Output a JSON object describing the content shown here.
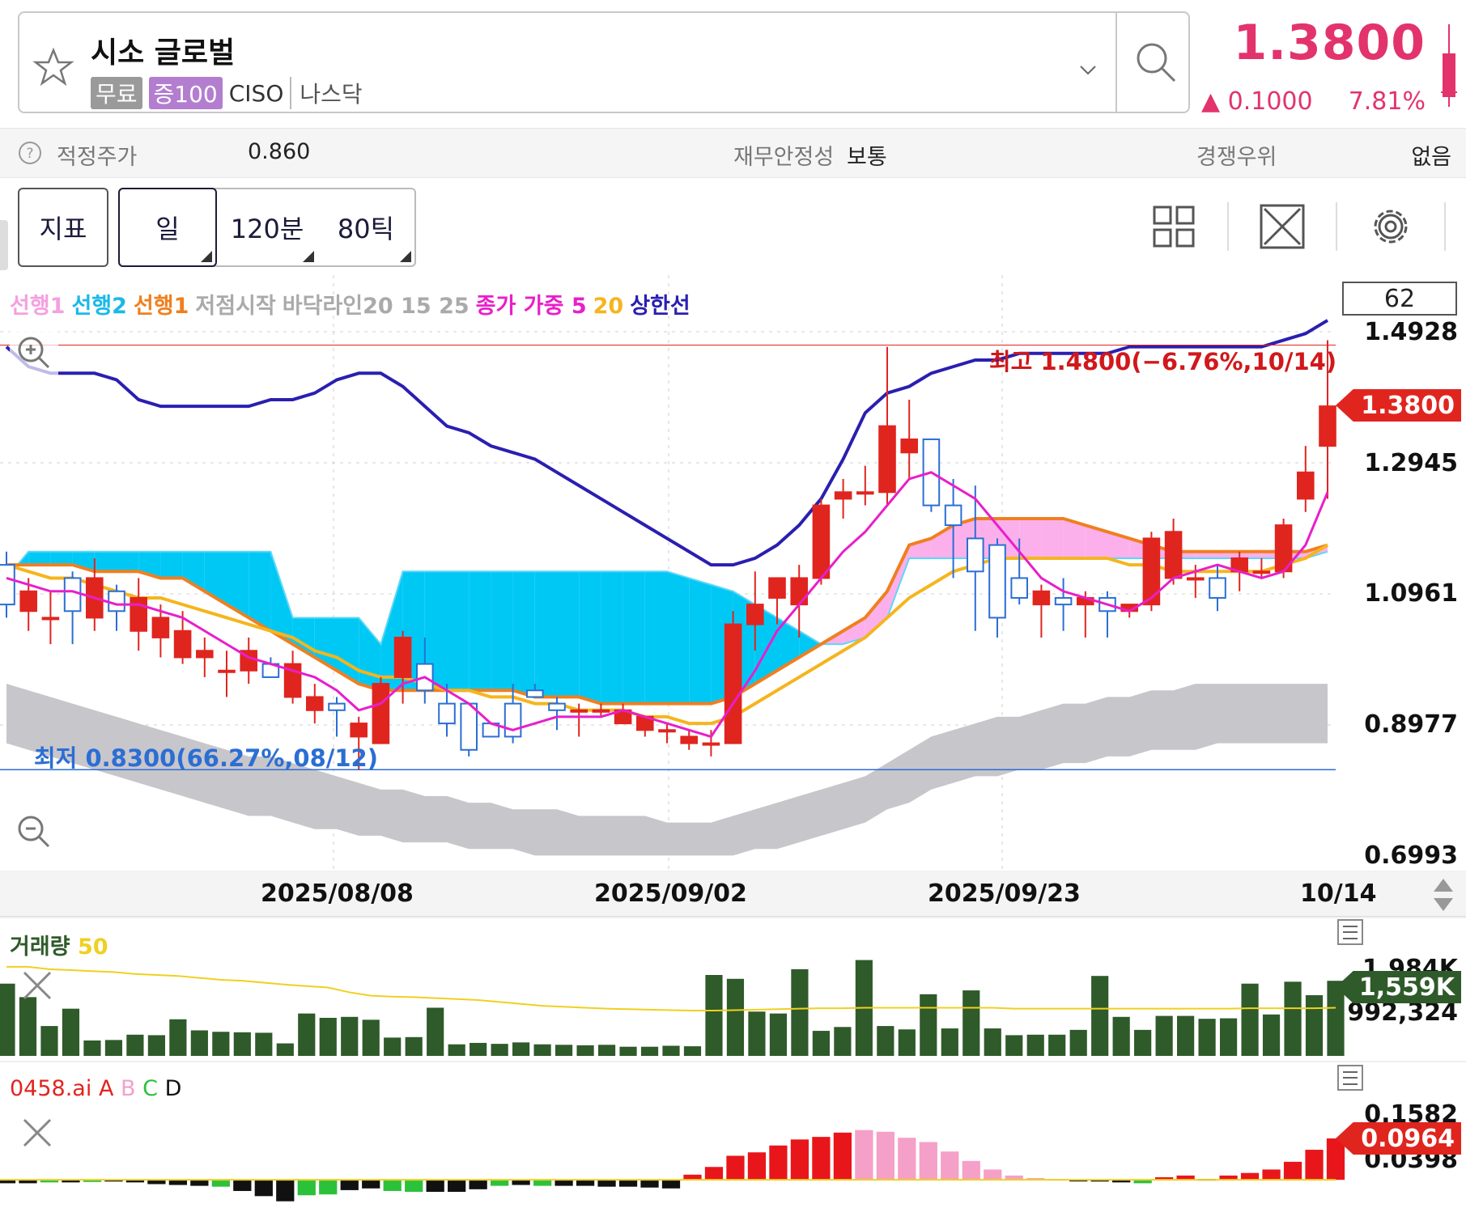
{
  "header": {
    "stock_name": "시소 글로벌",
    "tag_free": "무료",
    "tag_margin": "증100",
    "ticker": "CISO",
    "exchange": "나스닥",
    "price": "1.3800",
    "change": "▲ 0.1000",
    "change_pct": "7.81%",
    "accent_color": "#e2336d"
  },
  "info_row": {
    "fair_price_label": "적정주가",
    "fair_price_value": "0.860",
    "stability_label": "재무안정성",
    "stability_value": "보통",
    "competitive_label": "경쟁우위",
    "competitive_value": "없음"
  },
  "toolbar": {
    "indicator_btn": "지표",
    "period_day": "일",
    "period_120min": "120분",
    "period_80tick": "80틱",
    "icons": [
      "grid-layout-icon",
      "expand-icon",
      "gear-icon",
      "tools-icon"
    ]
  },
  "legend": {
    "lead1_pink": "선행1",
    "lead2": "선행2",
    "lead1_orange": "선행1",
    "low_start": "저점시작",
    "bottom_line": "바닥라인20 15 25",
    "close_weighted": "종가 가중 5",
    "ma20": "20",
    "upper": "상한선",
    "y_box": "62"
  },
  "price_chart": {
    "y_labels": [
      "1.4928",
      "1.2945",
      "1.0961",
      "0.8977",
      "0.6993"
    ],
    "x_labels": [
      "2025/08/08",
      "2025/09/02",
      "2025/09/23",
      "10/14"
    ],
    "high_annotation": "최고 1.4800(−6.76%,10/14)",
    "low_annotation": "최저 0.8300(66.27%,08/12)",
    "current_tag": "1.3800"
  },
  "volume_panel": {
    "title": "거래량",
    "ma_label": "50",
    "labels": [
      "1,984K",
      "992,324"
    ],
    "current_tag": "1,559K"
  },
  "ai_panel": {
    "title": "0458.ai",
    "a": "A",
    "b": "B",
    "c": "C",
    "d": "D",
    "labels": [
      "0.1582",
      "0.0398"
    ],
    "current_tag": "0.0964"
  },
  "chart_data": {
    "type": "candlestick",
    "ylim": [
      0.6993,
      1.4928
    ],
    "candles": [
      {
        "o": 1.14,
        "h": 1.16,
        "l": 1.06,
        "c": 1.08
      },
      {
        "o": 1.07,
        "h": 1.12,
        "l": 1.04,
        "c": 1.1
      },
      {
        "o": 1.06,
        "h": 1.1,
        "l": 1.02,
        "c": 1.06
      },
      {
        "o": 1.12,
        "h": 1.13,
        "l": 1.02,
        "c": 1.07
      },
      {
        "o": 1.06,
        "h": 1.15,
        "l": 1.04,
        "c": 1.12
      },
      {
        "o": 1.1,
        "h": 1.11,
        "l": 1.04,
        "c": 1.07
      },
      {
        "o": 1.04,
        "h": 1.12,
        "l": 1.01,
        "c": 1.09
      },
      {
        "o": 1.03,
        "h": 1.08,
        "l": 1.0,
        "c": 1.06
      },
      {
        "o": 1.0,
        "h": 1.07,
        "l": 0.99,
        "c": 1.04
      },
      {
        "o": 1.0,
        "h": 1.03,
        "l": 0.97,
        "c": 1.01
      },
      {
        "o": 0.98,
        "h": 1.01,
        "l": 0.94,
        "c": 0.98
      },
      {
        "o": 0.98,
        "h": 1.03,
        "l": 0.96,
        "c": 1.01
      },
      {
        "o": 0.99,
        "h": 1.0,
        "l": 0.97,
        "c": 0.97
      },
      {
        "o": 0.94,
        "h": 1.01,
        "l": 0.93,
        "c": 0.99
      },
      {
        "o": 0.92,
        "h": 0.96,
        "l": 0.9,
        "c": 0.94
      },
      {
        "o": 0.93,
        "h": 0.94,
        "l": 0.88,
        "c": 0.92
      },
      {
        "o": 0.88,
        "h": 0.91,
        "l": 0.83,
        "c": 0.9
      },
      {
        "o": 0.87,
        "h": 0.97,
        "l": 0.87,
        "c": 0.96
      },
      {
        "o": 0.97,
        "h": 1.04,
        "l": 0.93,
        "c": 1.03
      },
      {
        "o": 0.99,
        "h": 1.03,
        "l": 0.93,
        "c": 0.95
      },
      {
        "o": 0.93,
        "h": 0.96,
        "l": 0.88,
        "c": 0.9
      },
      {
        "o": 0.93,
        "h": 0.93,
        "l": 0.85,
        "c": 0.86
      },
      {
        "o": 0.9,
        "h": 0.9,
        "l": 0.88,
        "c": 0.88
      },
      {
        "o": 0.93,
        "h": 0.96,
        "l": 0.87,
        "c": 0.88
      },
      {
        "o": 0.95,
        "h": 0.96,
        "l": 0.94,
        "c": 0.94
      },
      {
        "o": 0.93,
        "h": 0.94,
        "l": 0.89,
        "c": 0.92
      },
      {
        "o": 0.92,
        "h": 0.93,
        "l": 0.88,
        "c": 0.92
      },
      {
        "o": 0.92,
        "h": 0.93,
        "l": 0.91,
        "c": 0.92
      },
      {
        "o": 0.9,
        "h": 0.93,
        "l": 0.9,
        "c": 0.92
      },
      {
        "o": 0.89,
        "h": 0.91,
        "l": 0.88,
        "c": 0.91
      },
      {
        "o": 0.89,
        "h": 0.9,
        "l": 0.87,
        "c": 0.89
      },
      {
        "o": 0.87,
        "h": 0.89,
        "l": 0.86,
        "c": 0.88
      },
      {
        "o": 0.87,
        "h": 0.89,
        "l": 0.85,
        "c": 0.87
      },
      {
        "o": 0.87,
        "h": 1.07,
        "l": 0.87,
        "c": 1.05
      },
      {
        "o": 1.05,
        "h": 1.13,
        "l": 1.01,
        "c": 1.08
      },
      {
        "o": 1.09,
        "h": 1.12,
        "l": 1.05,
        "c": 1.12
      },
      {
        "o": 1.08,
        "h": 1.14,
        "l": 1.03,
        "c": 1.12
      },
      {
        "o": 1.12,
        "h": 1.24,
        "l": 1.11,
        "c": 1.23
      },
      {
        "o": 1.24,
        "h": 1.27,
        "l": 1.21,
        "c": 1.25
      },
      {
        "o": 1.25,
        "h": 1.29,
        "l": 1.23,
        "c": 1.25
      },
      {
        "o": 1.25,
        "h": 1.47,
        "l": 1.23,
        "c": 1.35
      },
      {
        "o": 1.31,
        "h": 1.39,
        "l": 1.27,
        "c": 1.33
      },
      {
        "o": 1.33,
        "h": 1.33,
        "l": 1.22,
        "c": 1.23
      },
      {
        "o": 1.23,
        "h": 1.27,
        "l": 1.12,
        "c": 1.2
      },
      {
        "o": 1.18,
        "h": 1.26,
        "l": 1.04,
        "c": 1.13
      },
      {
        "o": 1.17,
        "h": 1.18,
        "l": 1.03,
        "c": 1.06
      },
      {
        "o": 1.12,
        "h": 1.18,
        "l": 1.08,
        "c": 1.09
      },
      {
        "o": 1.08,
        "h": 1.11,
        "l": 1.03,
        "c": 1.1
      },
      {
        "o": 1.09,
        "h": 1.12,
        "l": 1.04,
        "c": 1.08
      },
      {
        "o": 1.08,
        "h": 1.1,
        "l": 1.03,
        "c": 1.09
      },
      {
        "o": 1.09,
        "h": 1.1,
        "l": 1.03,
        "c": 1.07
      },
      {
        "o": 1.07,
        "h": 1.08,
        "l": 1.06,
        "c": 1.08
      },
      {
        "o": 1.08,
        "h": 1.19,
        "l": 1.07,
        "c": 1.18
      },
      {
        "o": 1.12,
        "h": 1.21,
        "l": 1.11,
        "c": 1.19
      },
      {
        "o": 1.12,
        "h": 1.14,
        "l": 1.09,
        "c": 1.12
      },
      {
        "o": 1.12,
        "h": 1.14,
        "l": 1.07,
        "c": 1.09
      },
      {
        "o": 1.13,
        "h": 1.16,
        "l": 1.1,
        "c": 1.15
      },
      {
        "o": 1.13,
        "h": 1.15,
        "l": 1.12,
        "c": 1.13
      },
      {
        "o": 1.13,
        "h": 1.21,
        "l": 1.12,
        "c": 1.2
      },
      {
        "o": 1.24,
        "h": 1.32,
        "l": 1.22,
        "c": 1.28
      },
      {
        "o": 1.32,
        "h": 1.48,
        "l": 1.24,
        "c": 1.38
      }
    ],
    "ma5": [
      1.12,
      1.11,
      1.1,
      1.1,
      1.09,
      1.08,
      1.08,
      1.07,
      1.06,
      1.04,
      1.02,
      1.0,
      0.99,
      0.98,
      0.97,
      0.95,
      0.92,
      0.93,
      0.96,
      0.97,
      0.95,
      0.93,
      0.9,
      0.89,
      0.9,
      0.91,
      0.91,
      0.91,
      0.92,
      0.91,
      0.9,
      0.89,
      0.88,
      0.93,
      0.98,
      1.04,
      1.08,
      1.12,
      1.16,
      1.19,
      1.23,
      1.27,
      1.28,
      1.26,
      1.24,
      1.2,
      1.16,
      1.12,
      1.1,
      1.09,
      1.08,
      1.07,
      1.09,
      1.12,
      1.13,
      1.14,
      1.13,
      1.12,
      1.13,
      1.17,
      1.25
    ],
    "ma20": [
      1.14,
      1.13,
      1.12,
      1.12,
      1.11,
      1.1,
      1.09,
      1.09,
      1.08,
      1.07,
      1.06,
      1.05,
      1.04,
      1.03,
      1.01,
      1.0,
      0.98,
      0.97,
      0.97,
      0.96,
      0.95,
      0.95,
      0.94,
      0.94,
      0.93,
      0.93,
      0.92,
      0.92,
      0.92,
      0.91,
      0.91,
      0.9,
      0.9,
      0.91,
      0.93,
      0.95,
      0.97,
      0.99,
      1.01,
      1.03,
      1.06,
      1.09,
      1.11,
      1.13,
      1.14,
      1.15,
      1.15,
      1.15,
      1.15,
      1.15,
      1.15,
      1.14,
      1.14,
      1.13,
      1.13,
      1.13,
      1.13,
      1.13,
      1.14,
      1.15,
      1.17
    ],
    "upper": [
      1.47,
      1.44,
      1.43,
      1.43,
      1.43,
      1.42,
      1.39,
      1.38,
      1.38,
      1.38,
      1.38,
      1.38,
      1.39,
      1.39,
      1.4,
      1.42,
      1.43,
      1.43,
      1.41,
      1.38,
      1.35,
      1.34,
      1.32,
      1.31,
      1.3,
      1.28,
      1.26,
      1.24,
      1.22,
      1.2,
      1.18,
      1.16,
      1.14,
      1.14,
      1.15,
      1.17,
      1.2,
      1.24,
      1.3,
      1.37,
      1.4,
      1.41,
      1.43,
      1.44,
      1.45,
      1.45,
      1.46,
      1.46,
      1.46,
      1.46,
      1.46,
      1.47,
      1.47,
      1.47,
      1.47,
      1.47,
      1.47,
      1.47,
      1.48,
      1.49,
      1.51
    ],
    "lead1": [
      1.14,
      1.14,
      1.14,
      1.14,
      1.13,
      1.13,
      1.13,
      1.12,
      1.12,
      1.1,
      1.08,
      1.06,
      1.04,
      1.02,
      1.0,
      0.98,
      0.96,
      0.95,
      0.95,
      0.95,
      0.95,
      0.95,
      0.95,
      0.95,
      0.94,
      0.94,
      0.94,
      0.93,
      0.93,
      0.93,
      0.93,
      0.93,
      0.93,
      0.94,
      0.96,
      0.98,
      1.0,
      1.02,
      1.04,
      1.06,
      1.1,
      1.17,
      1.18,
      1.2,
      1.21,
      1.21,
      1.21,
      1.21,
      1.21,
      1.2,
      1.19,
      1.18,
      1.17,
      1.16,
      1.16,
      1.16,
      1.16,
      1.16,
      1.16,
      1.16,
      1.17
    ],
    "lead2": [
      1.12,
      1.16,
      1.16,
      1.16,
      1.16,
      1.16,
      1.16,
      1.16,
      1.16,
      1.16,
      1.16,
      1.16,
      1.16,
      1.06,
      1.06,
      1.06,
      1.06,
      1.02,
      1.13,
      1.13,
      1.13,
      1.13,
      1.13,
      1.13,
      1.13,
      1.13,
      1.13,
      1.13,
      1.13,
      1.13,
      1.13,
      1.12,
      1.11,
      1.1,
      1.08,
      1.06,
      1.04,
      1.02,
      1.02,
      1.03,
      1.06,
      1.15,
      1.15,
      1.15,
      1.15,
      1.15,
      1.15,
      1.15,
      1.15,
      1.15,
      1.15,
      1.15,
      1.15,
      1.15,
      1.15,
      1.15,
      1.15,
      1.15,
      1.15,
      1.15,
      1.16
    ],
    "band_top": [
      0.96,
      0.95,
      0.94,
      0.93,
      0.92,
      0.91,
      0.9,
      0.89,
      0.88,
      0.87,
      0.86,
      0.85,
      0.85,
      0.84,
      0.83,
      0.82,
      0.81,
      0.8,
      0.8,
      0.79,
      0.79,
      0.78,
      0.78,
      0.77,
      0.77,
      0.77,
      0.76,
      0.76,
      0.76,
      0.76,
      0.75,
      0.75,
      0.75,
      0.76,
      0.77,
      0.78,
      0.79,
      0.8,
      0.81,
      0.82,
      0.84,
      0.86,
      0.88,
      0.89,
      0.9,
      0.91,
      0.91,
      0.92,
      0.93,
      0.93,
      0.94,
      0.94,
      0.95,
      0.95,
      0.96,
      0.96,
      0.96,
      0.96,
      0.96,
      0.96,
      0.96
    ],
    "band_bottom": [
      0.87,
      0.86,
      0.85,
      0.84,
      0.83,
      0.82,
      0.81,
      0.8,
      0.79,
      0.78,
      0.77,
      0.76,
      0.76,
      0.75,
      0.74,
      0.74,
      0.73,
      0.73,
      0.72,
      0.72,
      0.72,
      0.71,
      0.71,
      0.71,
      0.7,
      0.7,
      0.7,
      0.7,
      0.7,
      0.7,
      0.7,
      0.7,
      0.7,
      0.7,
      0.71,
      0.71,
      0.72,
      0.73,
      0.74,
      0.75,
      0.77,
      0.78,
      0.8,
      0.81,
      0.82,
      0.82,
      0.83,
      0.83,
      0.84,
      0.84,
      0.85,
      0.85,
      0.86,
      0.86,
      0.86,
      0.87,
      0.87,
      0.87,
      0.87,
      0.87,
      0.87
    ],
    "volume_ylim": [
      0,
      2100
    ],
    "volume": [
      1500,
      1220,
      620,
      980,
      320,
      330,
      440,
      430,
      760,
      530,
      500,
      490,
      480,
      260,
      880,
      790,
      810,
      750,
      380,
      390,
      1000,
      240,
      270,
      250,
      280,
      240,
      230,
      220,
      230,
      190,
      190,
      210,
      200,
      1680,
      1600,
      920,
      880,
      1800,
      520,
      600,
      1990,
      620,
      550,
      1280,
      570,
      1360,
      570,
      430,
      440,
      440,
      540,
      1660,
      810,
      540,
      830,
      830,
      770,
      780,
      1500,
      860,
      1540,
      1260,
      1559
    ],
    "volume_ma50": [
      1850,
      1850,
      1800,
      1780,
      1760,
      1740,
      1700,
      1680,
      1660,
      1620,
      1580,
      1560,
      1520,
      1480,
      1450,
      1420,
      1320,
      1250,
      1230,
      1220,
      1200,
      1180,
      1160,
      1120,
      1080,
      1040,
      1020,
      1000,
      980,
      970,
      960,
      950,
      940,
      940,
      950,
      960,
      970,
      980,
      990,
      990,
      1000,
      1000,
      1000,
      1000,
      1000,
      1000,
      1000,
      980,
      980,
      980,
      980,
      980,
      980,
      980,
      980,
      980,
      980,
      980,
      990,
      990,
      990,
      990,
      1000
    ],
    "ai_ylim": [
      -0.06,
      0.17
    ],
    "ai_values": [
      -0.008,
      -0.008,
      -0.006,
      -0.006,
      -0.005,
      -0.004,
      -0.006,
      -0.01,
      -0.012,
      -0.014,
      -0.016,
      -0.026,
      -0.038,
      -0.05,
      -0.036,
      -0.034,
      -0.024,
      -0.02,
      -0.026,
      -0.028,
      -0.028,
      -0.028,
      -0.022,
      -0.014,
      -0.012,
      -0.014,
      -0.014,
      -0.014,
      -0.016,
      -0.016,
      -0.018,
      -0.02,
      0.012,
      0.03,
      0.056,
      0.064,
      0.08,
      0.094,
      0.1,
      0.11,
      0.116,
      0.112,
      0.098,
      0.088,
      0.066,
      0.044,
      0.024,
      0.01,
      0.004,
      0.002,
      0.0,
      -0.004,
      -0.006,
      -0.008,
      0.006,
      0.01,
      0.002,
      0.01,
      0.016,
      0.024,
      0.042,
      0.07,
      0.0964
    ],
    "ai_colors": [
      "k",
      "k",
      "g",
      "k",
      "g",
      "k",
      "k",
      "k",
      "k",
      "k",
      "g",
      "k",
      "k",
      "k",
      "g",
      "g",
      "k",
      "k",
      "g",
      "g",
      "k",
      "k",
      "k",
      "g",
      "k",
      "g",
      "k",
      "k",
      "k",
      "k",
      "k",
      "k",
      "r",
      "r",
      "r",
      "r",
      "r",
      "r",
      "r",
      "r",
      "p",
      "p",
      "p",
      "p",
      "p",
      "p",
      "p",
      "p",
      "p",
      "p",
      "k",
      "k",
      "k",
      "g",
      "r",
      "r",
      "k",
      "r",
      "r",
      "r",
      "r",
      "r",
      "r"
    ]
  }
}
